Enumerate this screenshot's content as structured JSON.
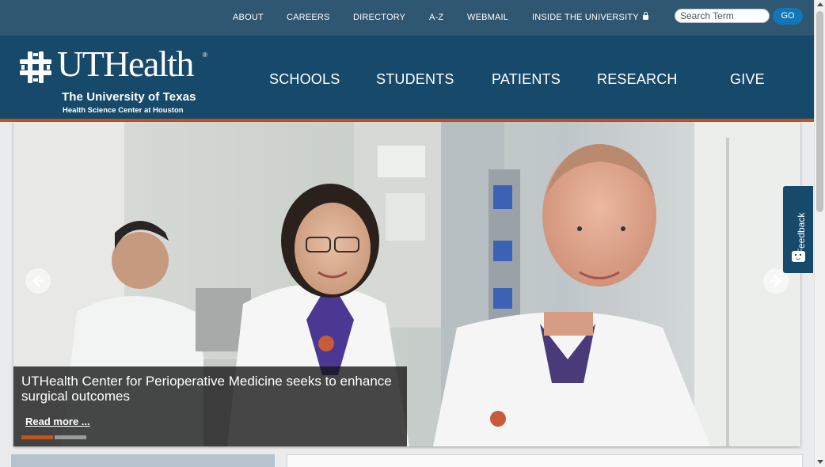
{
  "utility_nav": {
    "items": [
      {
        "label": "ABOUT"
      },
      {
        "label": "CAREERS"
      },
      {
        "label": "DIRECTORY"
      },
      {
        "label": "A-Z"
      },
      {
        "label": "WEBMAIL"
      },
      {
        "label": "INSIDE THE UNIVERSITY",
        "icon": "lock-icon"
      }
    ],
    "search": {
      "placeholder": "Search Term",
      "value": "",
      "button_label": "GO"
    }
  },
  "logo": {
    "wordmark": "UTHealth",
    "registered": "®",
    "line1": "The University of Texas",
    "line2": "Health Science Center at Houston"
  },
  "main_nav": {
    "items": [
      {
        "label": "SCHOOLS"
      },
      {
        "label": "STUDENTS"
      },
      {
        "label": "PATIENTS"
      },
      {
        "label": "RESEARCH"
      },
      {
        "label": "GIVE"
      }
    ]
  },
  "carousel": {
    "caption_title": "UTHealth Center for Perioperative Medicine seeks to enhance surgical outcomes",
    "read_more": "Read more ...",
    "slide_count": 2,
    "active_slide": 1
  },
  "feedback": {
    "label": "Feedback"
  },
  "colors": {
    "topbar": "#2f5771",
    "header": "#174a6a",
    "accent_orange": "#c4531e",
    "go_button": "#1276b8"
  }
}
